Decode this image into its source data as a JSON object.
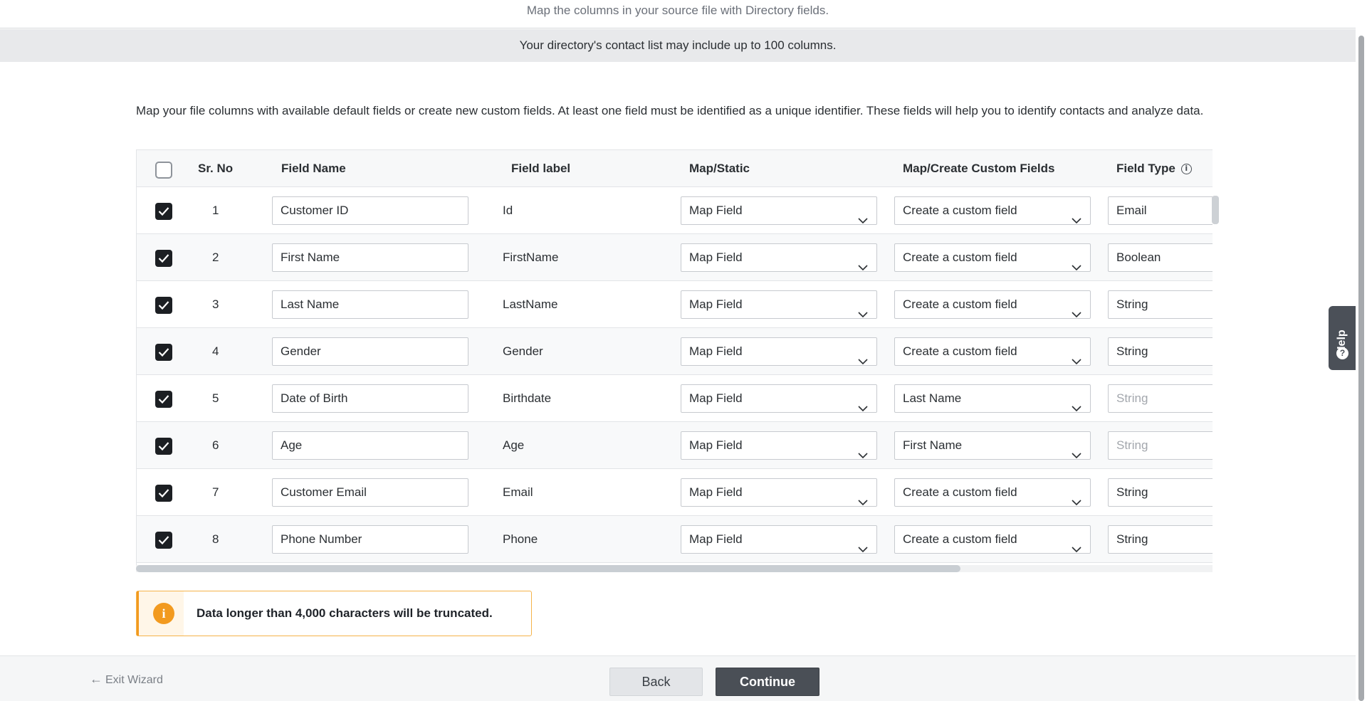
{
  "header": {
    "subtitle": "Map the columns in your source file with Directory fields.",
    "banner": "Your directory's contact list may include up to 100 columns."
  },
  "intro": "Map your file columns with available default fields or create new custom fields. At least one field must be identified as a unique identifier. These fields will help you to identify contacts and analyze data.",
  "table": {
    "columns": {
      "sr_no": "Sr. No",
      "field_name": "Field Name",
      "field_label": "Field label",
      "map_static": "Map/Static",
      "custom_fields": "Map/Create Custom Fields",
      "field_type": "Field Type"
    },
    "rows": [
      {
        "sr": "1",
        "field_name": "Customer ID",
        "field_label": "Id",
        "map_static": "Map Field",
        "custom": "Create a custom field",
        "field_type": "Email",
        "type_disabled": false
      },
      {
        "sr": "2",
        "field_name": "First Name",
        "field_label": "FirstName",
        "map_static": "Map Field",
        "custom": "Create a custom field",
        "field_type": "Boolean",
        "type_disabled": false
      },
      {
        "sr": "3",
        "field_name": "Last Name",
        "field_label": "LastName",
        "map_static": "Map Field",
        "custom": "Create a custom field",
        "field_type": "String",
        "type_disabled": false
      },
      {
        "sr": "4",
        "field_name": "Gender",
        "field_label": "Gender",
        "map_static": "Map Field",
        "custom": "Create a custom field",
        "field_type": "String",
        "type_disabled": false
      },
      {
        "sr": "5",
        "field_name": "Date of Birth",
        "field_label": "Birthdate",
        "map_static": "Map Field",
        "custom": "Last Name",
        "field_type": "String",
        "type_disabled": true
      },
      {
        "sr": "6",
        "field_name": "Age",
        "field_label": "Age",
        "map_static": "Map Field",
        "custom": "First Name",
        "field_type": "String",
        "type_disabled": true
      },
      {
        "sr": "7",
        "field_name": "Customer Email",
        "field_label": "Email",
        "map_static": "Map Field",
        "custom": "Create a custom field",
        "field_type": "String",
        "type_disabled": false
      },
      {
        "sr": "8",
        "field_name": "Phone Number",
        "field_label": "Phone",
        "map_static": "Map Field",
        "custom": "Create a custom field",
        "field_type": "String",
        "type_disabled": false
      }
    ]
  },
  "notice": {
    "text": "Data longer than 4,000 characters will be truncated.",
    "icon": "info-icon"
  },
  "footer": {
    "exit_label": "Exit Wizard",
    "back_label": "Back",
    "continue_label": "Continue"
  },
  "help": {
    "label": "Help"
  },
  "colors": {
    "accent_warning": "#f29a1f",
    "primary_button": "#4a4f56",
    "checkbox_checked": "#1c1f23"
  }
}
